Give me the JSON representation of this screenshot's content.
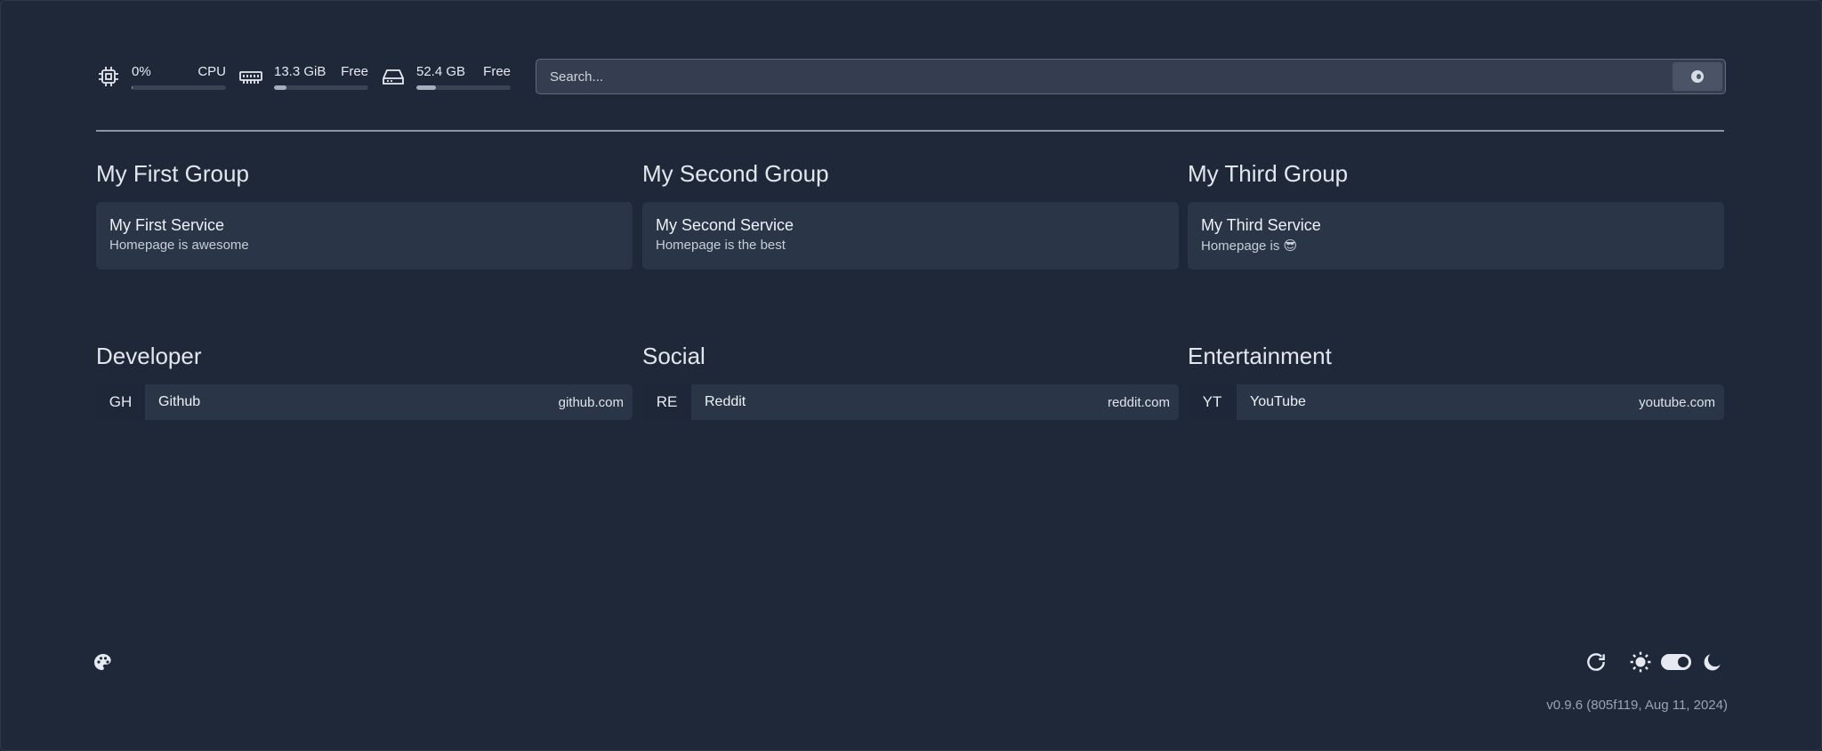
{
  "widgets": {
    "cpu": {
      "value": "0%",
      "label": "CPU",
      "usage_fraction": 0.01,
      "icon": "cpu-icon"
    },
    "memory": {
      "value": "13.3 GiB",
      "label": "Free",
      "usage_fraction": 0.13,
      "icon": "memory-icon"
    },
    "disk": {
      "value": "52.4 GB",
      "label": "Free",
      "usage_fraction": 0.21,
      "icon": "disk-icon"
    }
  },
  "search": {
    "placeholder": "Search...",
    "engine_icon": "search-engine-icon"
  },
  "groups": [
    {
      "title": "My First Group",
      "service": {
        "name": "My First Service",
        "description": "Homepage is awesome"
      }
    },
    {
      "title": "My Second Group",
      "service": {
        "name": "My Second Service",
        "description": "Homepage is the best"
      }
    },
    {
      "title": "My Third Group",
      "service": {
        "name": "My Third Service",
        "description": "Homepage is 😎"
      }
    }
  ],
  "bookmark_groups": [
    {
      "title": "Developer",
      "bookmark": {
        "abbr": "GH",
        "name": "Github",
        "url": "github.com"
      }
    },
    {
      "title": "Social",
      "bookmark": {
        "abbr": "RE",
        "name": "Reddit",
        "url": "reddit.com"
      }
    },
    {
      "title": "Entertainment",
      "bookmark": {
        "abbr": "YT",
        "name": "YouTube",
        "url": "youtube.com"
      }
    }
  ],
  "footer": {
    "version": "v0.9.6 (805f119, Aug 11, 2024)",
    "theme_toggle_dark": true
  },
  "colors": {
    "background": "#1f2839",
    "card": "#2a3547",
    "accent": "#e6eaf0"
  }
}
